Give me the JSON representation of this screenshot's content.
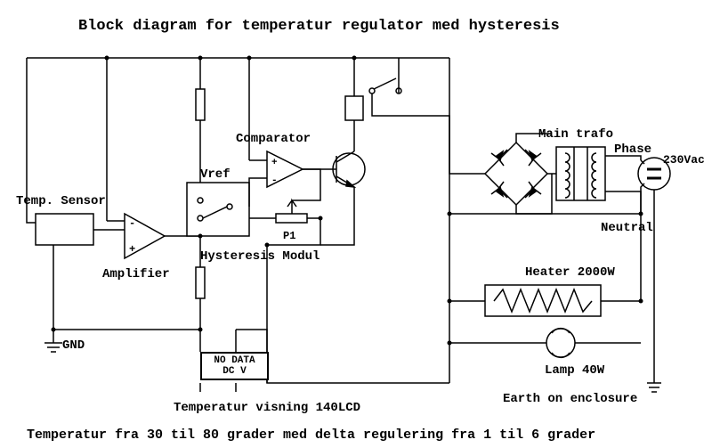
{
  "title": "Block diagram for temperatur regulator med hysteresis",
  "labels": {
    "temp_sensor": "Temp. Sensor",
    "amplifier": "Amplifier",
    "vref": "Vref",
    "comparator": "Comparator",
    "p1": "P1",
    "hysteresis_modul": "Hysteresis Modul",
    "gnd": "GND",
    "main_trafo": "Main trafo",
    "phase": "Phase",
    "volt": "230Vac",
    "neutral": "Neutral",
    "heater": "Heater 2000W",
    "lamp": "Lamp 40W",
    "earth": "Earth on enclosure",
    "lcd_line1": "NO DATA",
    "lcd_line2": "DC V",
    "temp_visning": "Temperatur visning 140LCD"
  },
  "footer": "Temperatur fra 30 til 80 grader med delta regulering fra 1 til 6 grader"
}
